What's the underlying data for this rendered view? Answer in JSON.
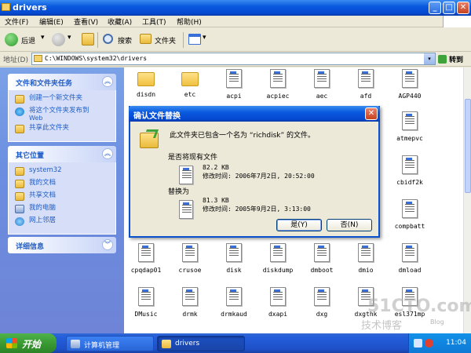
{
  "window": {
    "title": "drivers",
    "controls": {
      "minimize": "_",
      "maximize": "□",
      "close": "✕"
    }
  },
  "menubar": [
    "文件(F)",
    "编辑(E)",
    "查看(V)",
    "收藏(A)",
    "工具(T)",
    "帮助(H)"
  ],
  "toolbar": {
    "back": "后退",
    "search": "搜索",
    "folders": "文件夹",
    "dropdown": "▾"
  },
  "address": {
    "label": "地址(D)",
    "value": "C:\\WINDOWS\\system32\\drivers",
    "go": "转到",
    "dropdown": "▾"
  },
  "left_pane": {
    "file_tasks": {
      "title": "文件和文件夹任务",
      "items": [
        {
          "label": "创建一个新文件夹",
          "icon": "new-folder-icon"
        },
        {
          "label": "将这个文件夹发布到",
          "sub": "Web",
          "icon": "publish-web-icon"
        },
        {
          "label": "共享此文件夹",
          "icon": "share-folder-icon"
        }
      ]
    },
    "other_places": {
      "title": "其它位置",
      "items": [
        {
          "label": "system32",
          "icon": "folder-icon"
        },
        {
          "label": "我的文档",
          "icon": "my-documents-icon"
        },
        {
          "label": "共享文档",
          "icon": "shared-documents-icon"
        },
        {
          "label": "我的电脑",
          "icon": "my-computer-icon"
        },
        {
          "label": "网上邻居",
          "icon": "network-places-icon"
        }
      ]
    },
    "details": {
      "title": "详细信息"
    },
    "chevron_up": "︽",
    "chevron_down": "︾"
  },
  "files": {
    "row1": [
      "disdn",
      "etc",
      "acpi",
      "acpiec",
      "aec",
      "afd",
      "AGP440"
    ],
    "right_column": [
      "atmepvc",
      "cbidf2k",
      "compbatt"
    ],
    "row4": [
      "cpqdap01",
      "crusoe",
      "disk",
      "diskdump",
      "dmboot",
      "dmio",
      "dmload"
    ],
    "row5": [
      "DMusic",
      "drmk",
      "drmkaud",
      "dxapi",
      "dxg",
      "dxgthk",
      "esl371mp"
    ]
  },
  "dialog": {
    "title": "确认文件替换",
    "message": "此文件夹已包含一个名为 “richdisk” 的文件。",
    "replace_question": "是否将现有文件",
    "existing": {
      "size": "82.2 KB",
      "modified": "修改时间: 2006年7月2日, 20:52:00"
    },
    "replace_with": "替换为",
    "new": {
      "size": "81.3 KB",
      "modified": "修改时间: 2005年9月2日, 3:13:00"
    },
    "yes": "是(Y)",
    "no": "否(N)"
  },
  "taskbar": {
    "start": "开始",
    "tasks": [
      "计算机管理",
      "drivers"
    ],
    "clock": "11:04"
  },
  "watermark": {
    "line1": "51CTO.com",
    "line2": "技术博客",
    "line3": "Blog"
  }
}
